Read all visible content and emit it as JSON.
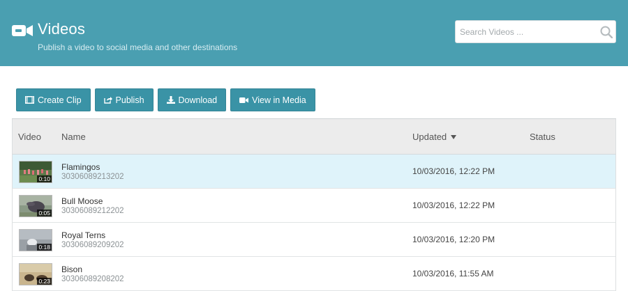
{
  "header": {
    "title": "Videos",
    "subtitle": "Publish a video to social media and other destinations",
    "icon": "video-camera-icon",
    "background": "#4a9fb1"
  },
  "search": {
    "placeholder": "Search Videos ...",
    "value": "",
    "icon": "search-icon"
  },
  "toolbar": {
    "button_color": "#3a93a6",
    "buttons": [
      {
        "label": "Create Clip",
        "icon": "film-icon"
      },
      {
        "label": "Publish",
        "icon": "share-icon"
      },
      {
        "label": "Download",
        "icon": "download-icon"
      },
      {
        "label": "View in Media",
        "icon": "video-camera-icon"
      }
    ]
  },
  "table": {
    "columns": {
      "video": "Video",
      "name": "Name",
      "updated": "Updated",
      "status": "Status",
      "sort_icon": "caret-down-icon"
    },
    "selected_row_color": "#dff3fa",
    "rows": [
      {
        "name": "Flamingos",
        "id": "30306089213202",
        "duration": "0:10",
        "updated": "10/03/2016, 12:22 PM",
        "status": "",
        "selected": true
      },
      {
        "name": "Bull Moose",
        "id": "30306089212202",
        "duration": "0:05",
        "updated": "10/03/2016, 12:22 PM",
        "status": "",
        "selected": false
      },
      {
        "name": "Royal Terns",
        "id": "30306089209202",
        "duration": "0:18",
        "updated": "10/03/2016, 12:20 PM",
        "status": "",
        "selected": false
      },
      {
        "name": "Bison",
        "id": "30306089208202",
        "duration": "0:23",
        "updated": "10/03/2016, 11:55 AM",
        "status": "",
        "selected": false
      }
    ]
  }
}
